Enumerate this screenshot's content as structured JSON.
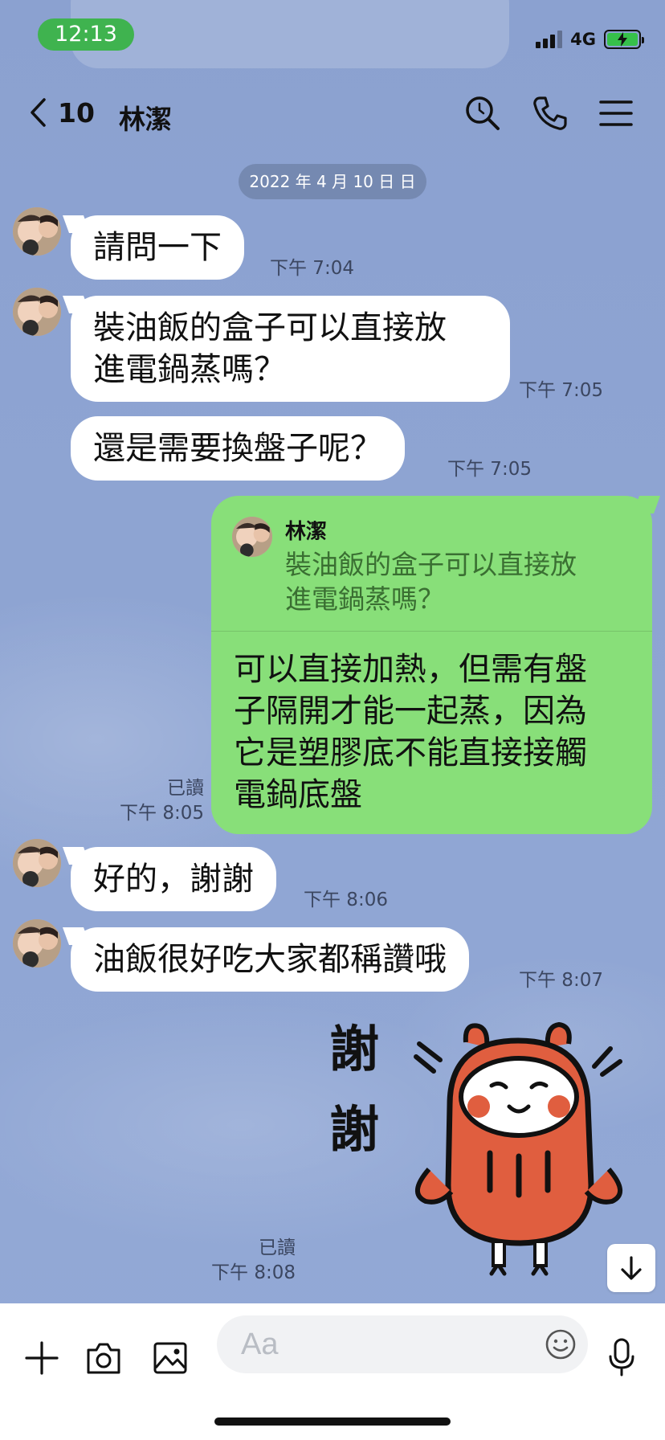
{
  "status_bar": {
    "time": "12:13",
    "network": "4G"
  },
  "header": {
    "back_count": "10",
    "title": "林潔"
  },
  "date_separator": "2022 年 4 月 10 日 日",
  "messages": [
    {
      "text": "請問一下",
      "time": "下午 7:04"
    },
    {
      "text_lines": [
        "裝油飯的盒子可以直接放",
        "進電鍋蒸嗎？"
      ],
      "time": "下午 7:05"
    },
    {
      "text": "還是需要換盤子呢？",
      "time": "下午 7:05"
    },
    {
      "text": "好的，謝謝",
      "time": "下午 8:06"
    },
    {
      "text": "油飯很好吃大家都稱讚哦",
      "time": "下午 8:07"
    }
  ],
  "sent_reply": {
    "quote_name": "林潔",
    "quote_lines": [
      "裝油飯的盒子可以直接放",
      "進電鍋蒸嗎？"
    ],
    "text_lines": [
      "可以直接加熱，但需有盤",
      "子隔開才能一起蒸，因為",
      "它是塑膠底不能直接接觸",
      "電鍋底盤"
    ],
    "read": "已讀",
    "time": "下午 8:05"
  },
  "sticker": {
    "word1": "謝",
    "word2": "謝",
    "read": "已讀",
    "time": "下午 8:08"
  },
  "input": {
    "placeholder": "Aa"
  },
  "icons": [
    "back-chevron-icon",
    "search-icon",
    "phone-icon",
    "menu-icon",
    "plus-icon",
    "camera-icon",
    "image-icon",
    "emoji-icon",
    "microphone-icon",
    "arrow-down-icon"
  ],
  "colors": {
    "background": "#8ea4d2",
    "sent_bubble": "#88df79",
    "received_bubble": "#ffffff",
    "status_pill": "#3fb34f"
  }
}
